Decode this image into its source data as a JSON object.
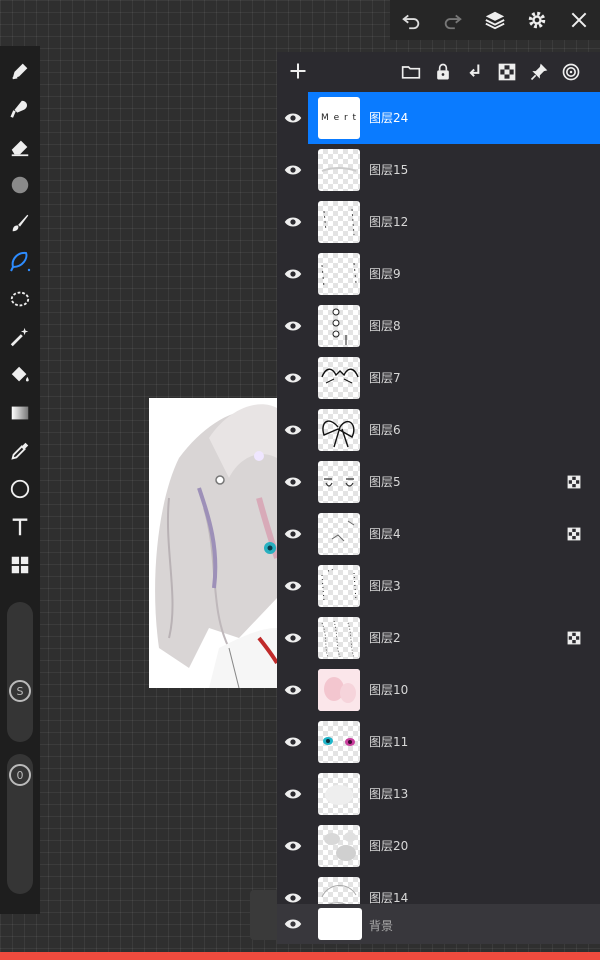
{
  "topbar": {
    "icons": [
      "undo-icon",
      "redo-icon",
      "layers-icon",
      "gear-icon",
      "close-icon"
    ]
  },
  "toolbar": {
    "tools": [
      "pen-icon",
      "smudge-icon",
      "eraser-icon",
      "blur-icon",
      "brush-icon",
      "lasso-pen-icon",
      "lasso-select-icon",
      "magic-wand-icon",
      "fill-bucket-icon",
      "gradient-icon",
      "eyedropper-icon",
      "circle-shape-icon",
      "text-icon",
      "grid-icon"
    ],
    "size_label": "S",
    "opacity_label": "0"
  },
  "layers_panel": {
    "header_icons": [
      "add-layer-icon",
      "folder-icon",
      "lock-icon",
      "merge-down-icon",
      "checker-icon",
      "pin-icon",
      "target-icon"
    ],
    "layers": [
      {
        "name": "图层24",
        "selected": true,
        "thumb_text": "M e r t",
        "lock": false
      },
      {
        "name": "图层15",
        "selected": false,
        "lock": false
      },
      {
        "name": "图层12",
        "selected": false,
        "lock": false
      },
      {
        "name": "图层9",
        "selected": false,
        "lock": false
      },
      {
        "name": "图层8",
        "selected": false,
        "lock": false
      },
      {
        "name": "图层7",
        "selected": false,
        "lock": false
      },
      {
        "name": "图层6",
        "selected": false,
        "lock": false
      },
      {
        "name": "图层5",
        "selected": false,
        "lock": true
      },
      {
        "name": "图层4",
        "selected": false,
        "lock": true
      },
      {
        "name": "图层3",
        "selected": false,
        "lock": false
      },
      {
        "name": "图层2",
        "selected": false,
        "lock": true
      },
      {
        "name": "图层10",
        "selected": false,
        "lock": false
      },
      {
        "name": "图层11",
        "selected": false,
        "lock": false
      },
      {
        "name": "图层13",
        "selected": false,
        "lock": false
      },
      {
        "name": "图层20",
        "selected": false,
        "lock": false
      },
      {
        "name": "图层14",
        "selected": false,
        "lock": false
      }
    ],
    "background_layer": {
      "name": "背景"
    }
  },
  "colors": {
    "accent": "#0a7bff",
    "panel": "#2b2a2f",
    "bottom_bar": "#f04b3e"
  }
}
